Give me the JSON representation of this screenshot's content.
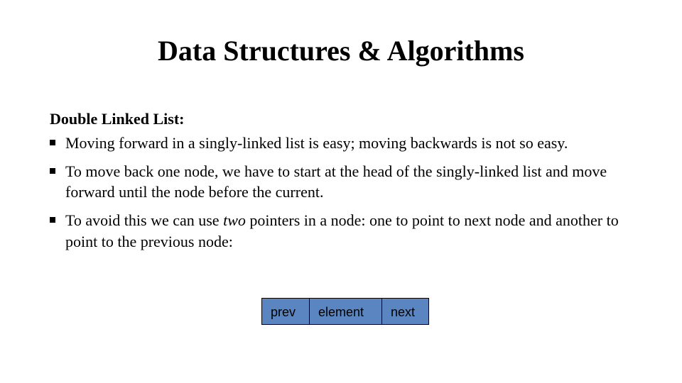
{
  "title": "Data Structures & Algorithms",
  "subtitle": "Double Linked List:",
  "bullets": [
    {
      "pre": "Moving forward in a singly-linked list is easy; moving backwards is not so easy.",
      "em": "",
      "post": ""
    },
    {
      "pre": "To move back one node, we have to start at the head of the singly-linked list and move forward until the node before the current.",
      "em": "",
      "post": ""
    },
    {
      "pre": "To avoid this we can use ",
      "em": "two",
      "post": " pointers in a node: one to point to next node and another to point to the previous node:"
    }
  ],
  "node": {
    "prev": "prev",
    "element": "element",
    "next": "next"
  }
}
